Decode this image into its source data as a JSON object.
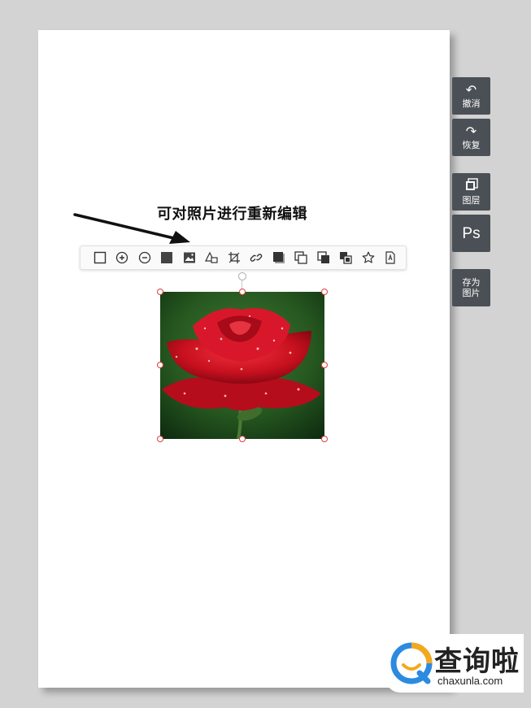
{
  "annotation": {
    "text": "可对照片进行重新编辑"
  },
  "toolbar": {
    "buttons": [
      {
        "name": "rectangle-tool",
        "icon": "square-outline-icon"
      },
      {
        "name": "zoom-in-tool",
        "icon": "plus-circle-icon"
      },
      {
        "name": "zoom-out-tool",
        "icon": "minus-circle-icon"
      },
      {
        "name": "fill-tool",
        "icon": "filled-square-icon"
      },
      {
        "name": "replace-image-tool",
        "icon": "image-icon"
      },
      {
        "name": "shape-tool",
        "icon": "triangle-square-icon"
      },
      {
        "name": "crop-tool",
        "icon": "crop-icon"
      },
      {
        "name": "link-tool",
        "icon": "link-icon"
      },
      {
        "name": "shadow-tool",
        "icon": "shadow-square-icon"
      },
      {
        "name": "copy-tool",
        "icon": "copy-icon"
      },
      {
        "name": "bring-forward-tool",
        "icon": "layer-forward-icon"
      },
      {
        "name": "send-backward-tool",
        "icon": "layer-backward-icon"
      },
      {
        "name": "favorite-tool",
        "icon": "star-icon"
      },
      {
        "name": "text-tool",
        "icon": "text-page-icon"
      }
    ]
  },
  "sidebar": {
    "undo": {
      "label": "撤消",
      "icon": "undo-icon"
    },
    "redo": {
      "label": "恢复",
      "icon": "redo-icon"
    },
    "layers": {
      "label": "图层",
      "icon": "layers-icon"
    },
    "ps": {
      "label": "Ps"
    },
    "save_image": {
      "line1": "存为",
      "line2": "图片"
    }
  },
  "watermark": {
    "brand": "查询啦",
    "url": "chaxunla.com"
  },
  "colors": {
    "accent": "#e03c3c",
    "sidebar_bg": "#4b5056",
    "page_bg": "#d3d3d3"
  }
}
